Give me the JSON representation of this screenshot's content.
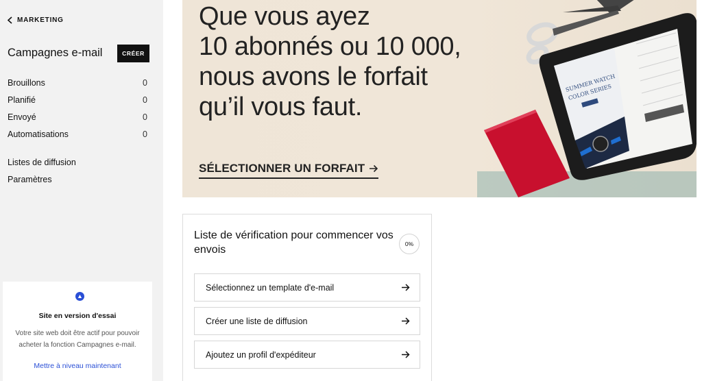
{
  "sidebar": {
    "back_label": "MARKETING",
    "title": "Campagnes e-mail",
    "create_label": "CRÉER",
    "items": [
      {
        "label": "Brouillons",
        "count": "0"
      },
      {
        "label": "Planifié",
        "count": "0"
      },
      {
        "label": "Envoyé",
        "count": "0"
      },
      {
        "label": "Automatisations",
        "count": "0"
      }
    ],
    "links": [
      {
        "label": "Listes de diffusion"
      },
      {
        "label": "Paramètres"
      }
    ],
    "trial": {
      "icon": "warning-triangle-icon",
      "title": "Site en version d'essai",
      "text": "Votre site web doit être actif pour pouvoir acheter la fonction Campagnes e-mail.",
      "link": "Mettre à niveau maintenant"
    }
  },
  "banner": {
    "headline_lines": [
      "Que vous ayez",
      "10 abonnés ou 10 000,",
      "nous avons le forfait",
      "qu’il vous faut."
    ],
    "cta_label": "SÉLECTIONNER UN FORFAIT",
    "tablet_text": {
      "line1": "SUMMER WATCH",
      "line2": "COLOR SERIES"
    }
  },
  "checklist": {
    "title": "Liste de vérification pour commencer vos envois",
    "progress": "0%",
    "items": [
      {
        "label": "Sélectionnez un template d'e-mail"
      },
      {
        "label": "Créer une liste de diffusion"
      },
      {
        "label": "Ajoutez un profil d'expéditeur"
      }
    ]
  },
  "colors": {
    "accent": "#2a4fd6",
    "sidebar_bg": "#f2f2f2",
    "banner_bg": "#efe5d7",
    "button_bg": "#111111"
  }
}
